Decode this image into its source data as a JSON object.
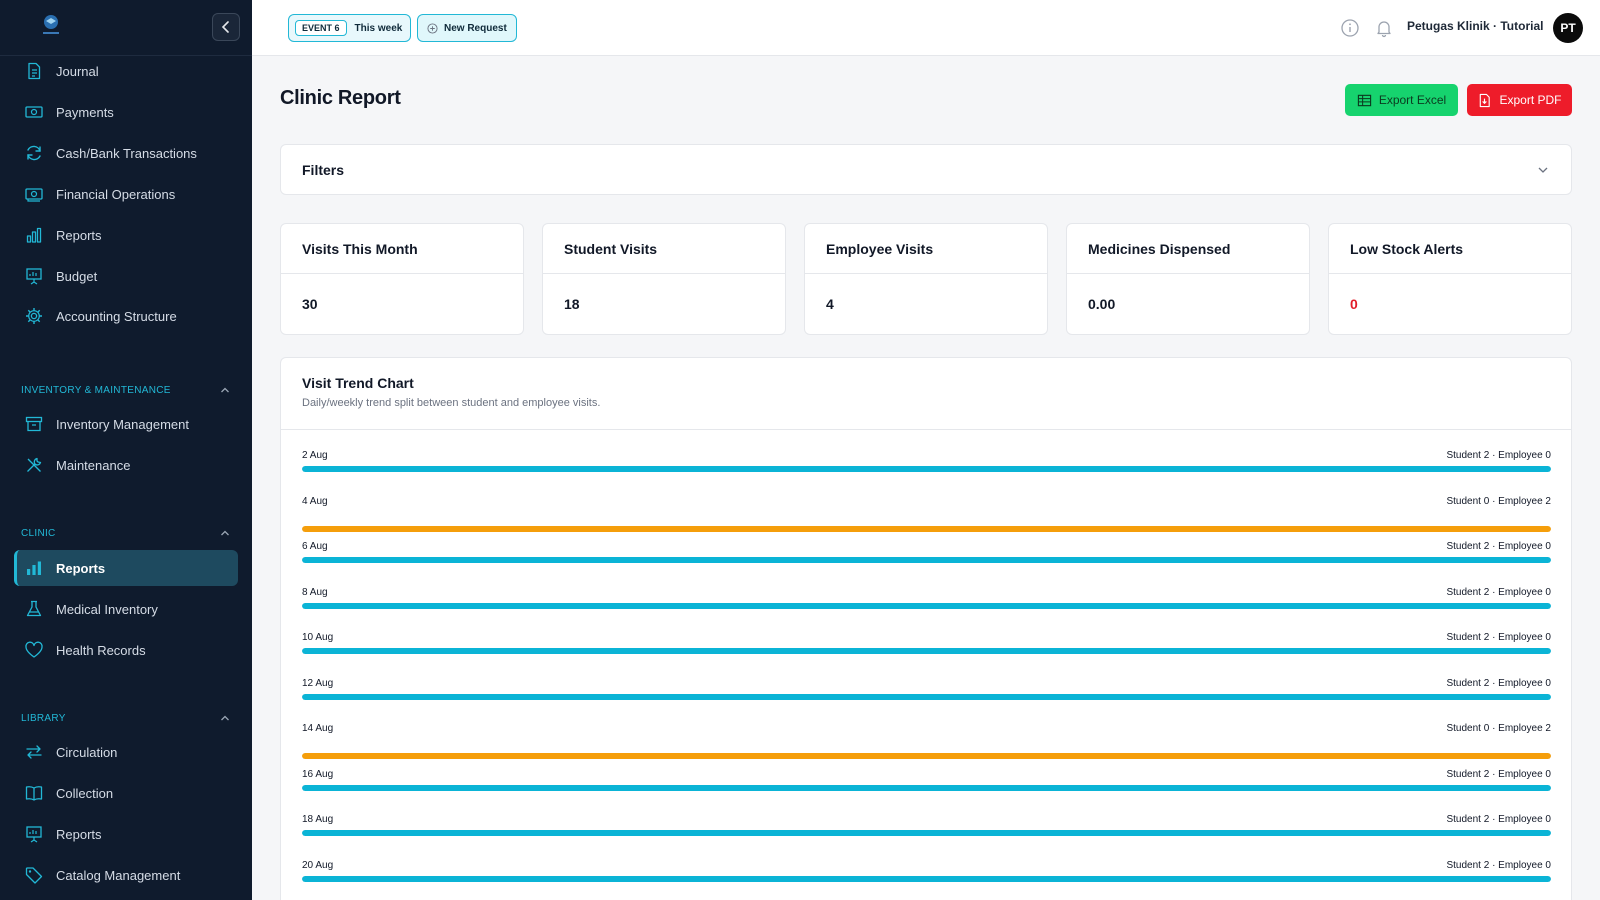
{
  "colors": {
    "sidebar_bg": "#0f1b2d",
    "accent": "#22b8d6",
    "student": "#0bb4d6",
    "employee": "#f59e0b",
    "excel": "#16d36e",
    "pdf": "#ee1c2a",
    "danger": "#e11d2a"
  },
  "sidebar": {
    "logo_icon": "school-logo-icon",
    "items_top": [
      {
        "label": "Journal",
        "icon": "journal-icon"
      },
      {
        "label": "Payments",
        "icon": "payments-icon"
      },
      {
        "label": "Cash/Bank Transactions",
        "icon": "refresh-icon"
      },
      {
        "label": "Financial Operations",
        "icon": "cash-icon"
      },
      {
        "label": "Reports",
        "icon": "bar-chart-icon"
      },
      {
        "label": "Budget",
        "icon": "presentation-chart-icon"
      },
      {
        "label": "Accounting Structure",
        "icon": "gear-icon"
      }
    ],
    "sections": [
      {
        "title": "INVENTORY & MAINTENANCE",
        "items": [
          {
            "label": "Inventory Management",
            "icon": "archive-box-icon"
          },
          {
            "label": "Maintenance",
            "icon": "wrench-screwdriver-icon"
          }
        ]
      },
      {
        "title": "CLINIC",
        "items": [
          {
            "label": "Reports",
            "icon": "bar-chart-icon",
            "active": true
          },
          {
            "label": "Medical Inventory",
            "icon": "flask-icon"
          },
          {
            "label": "Health Records",
            "icon": "heart-icon"
          }
        ]
      },
      {
        "title": "LIBRARY",
        "items": [
          {
            "label": "Circulation",
            "icon": "arrows-swap-icon"
          },
          {
            "label": "Collection",
            "icon": "book-open-icon"
          },
          {
            "label": "Reports",
            "icon": "presentation-chart-icon"
          },
          {
            "label": "Catalog Management",
            "icon": "tag-icon"
          }
        ]
      }
    ]
  },
  "header": {
    "event_tag": "EVENT 6",
    "event_range": "This week",
    "new_request": "New Request",
    "user_name": "Petugas Klinik · Tutorial",
    "avatar_initials": "PT"
  },
  "main": {
    "title": "Clinic Report",
    "export_excel": "Export Excel",
    "export_pdf": "Export PDF",
    "filters_label": "Filters",
    "stats": [
      {
        "title": "Visits This Month",
        "value": "30"
      },
      {
        "title": "Student Visits",
        "value": "18"
      },
      {
        "title": "Employee Visits",
        "value": "4"
      },
      {
        "title": "Medicines Dispensed",
        "value": "0.00"
      },
      {
        "title": "Low Stock Alerts",
        "value": "0",
        "danger": true
      }
    ],
    "chart_title": "Visit Trend Chart",
    "chart_subtitle": "Daily/weekly trend split between student and employee visits."
  },
  "chart_data": {
    "type": "bar",
    "title": "Visit Trend Chart",
    "subtitle": "Daily/weekly trend split between student and employee visits.",
    "orientation": "horizontal-stacked-progress",
    "categories": [
      "2 Aug",
      "4 Aug",
      "6 Aug",
      "8 Aug",
      "10 Aug",
      "12 Aug",
      "14 Aug",
      "16 Aug",
      "18 Aug",
      "20 Aug"
    ],
    "series": [
      {
        "name": "Student",
        "values": [
          2,
          0,
          2,
          2,
          2,
          2,
          0,
          2,
          2,
          2
        ]
      },
      {
        "name": "Employee",
        "values": [
          0,
          2,
          0,
          0,
          0,
          0,
          2,
          0,
          0,
          0
        ]
      }
    ],
    "row_labels": [
      "Student 2 · Employee 0",
      "Student 0 · Employee 2",
      "Student 2 · Employee 0",
      "Student 2 · Employee 0",
      "Student 2 · Employee 0",
      "Student 2 · Employee 0",
      "Student 0 · Employee 2",
      "Student 2 · Employee 0",
      "Student 2 · Employee 0",
      "Student 2 · Employee 0"
    ]
  }
}
